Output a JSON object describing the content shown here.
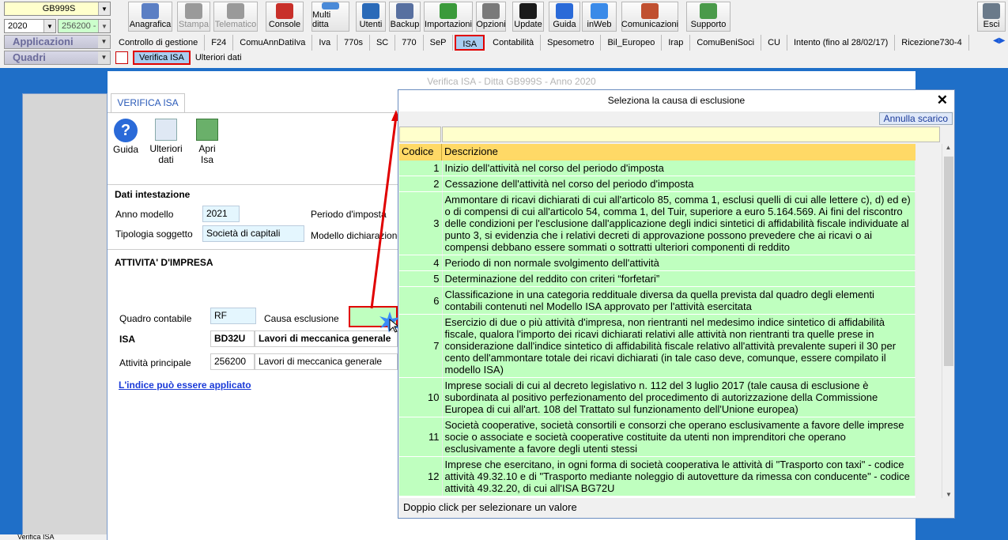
{
  "toolbar": {
    "company": "GB999S",
    "year": "2020",
    "code": "256200 -",
    "buttons": [
      {
        "label": "Anagrafica",
        "icon": "anagrafica-icon",
        "color": "#5b7fc4",
        "enabled": true
      },
      {
        "label": "Stampa",
        "icon": "printer-icon",
        "color": "#9a9a9a",
        "enabled": false
      },
      {
        "label": "Telematico",
        "icon": "telematico-icon",
        "color": "#9a9a9a",
        "enabled": false
      },
      {
        "label": "Console",
        "icon": "console-icon",
        "color": "#c8302a",
        "enabled": true
      },
      {
        "label": "Multi ditta",
        "icon": "multi-ditta-icon",
        "color": "#4a8ad8",
        "enabled": true
      },
      {
        "label": "Utenti",
        "icon": "users-icon",
        "color": "#2a6ab8",
        "enabled": true
      },
      {
        "label": "Backup",
        "icon": "backup-icon",
        "color": "#5870a0",
        "enabled": true
      },
      {
        "label": "Importazioni",
        "icon": "import-icon",
        "color": "#3a9a3a",
        "enabled": true
      },
      {
        "label": "Opzioni",
        "icon": "wrench-icon",
        "color": "#7a7a7a",
        "enabled": true
      },
      {
        "label": "Update",
        "icon": "update-icon",
        "color": "#1a1a1a",
        "enabled": true
      },
      {
        "label": "Guida",
        "icon": "help-icon",
        "color": "#2a6ad8",
        "enabled": true
      },
      {
        "label": "inWeb",
        "icon": "cloud-icon",
        "color": "#3a8ae8",
        "enabled": true
      },
      {
        "label": "Comunicazioni",
        "icon": "comunicazioni-icon",
        "color": "#c05030",
        "enabled": true
      },
      {
        "label": "Supporto",
        "icon": "support-icon",
        "color": "#4a9a4a",
        "enabled": true
      }
    ],
    "exit_label": "Esci"
  },
  "side": {
    "applicazioni": "Applicazioni",
    "quadri": "Quadri"
  },
  "tabs": [
    "Controllo di gestione",
    "F24",
    "ComuAnnDatiIva",
    "Iva",
    "770s",
    "SC",
    "770",
    "SeP",
    "ISA",
    "Contabilità",
    "Spesometro",
    "Bil_Europeo",
    "Irap",
    "ComuBeniSoci",
    "CU",
    "Intento (fino al 28/02/17)",
    "Ricezione730-4"
  ],
  "active_tab": "ISA",
  "subtabs": {
    "verifica": "Verifica ISA",
    "ulteriori": "Ulteriori dati"
  },
  "main": {
    "title": "Verifica ISA - Ditta GB999S - Anno 2020",
    "tab": "VERIFICA ISA",
    "actions": {
      "guida": "Guida",
      "ulteriori": "Ulteriori dati",
      "apri": "Apri Isa"
    },
    "intestazione": "Dati intestazione",
    "anno_label": "Anno modello",
    "anno": "2021",
    "periodo_label": "Periodo d'imposta",
    "tipologia_label": "Tipologia soggetto",
    "tipologia": "Società di capitali",
    "modello_label": "Modello dichiarazione",
    "attivita_title": "ATTIVITA' D'IMPRESA",
    "quadro_label": "Quadro contabile",
    "quadro": "RF",
    "causa_label": "Causa esclusione",
    "isa_label": "ISA",
    "isa_code": "BD32U",
    "isa_desc": "Lavori di meccanica generale",
    "att_label": "Attività principale",
    "att_code": "256200",
    "att_desc": "Lavori di meccanica generale",
    "link": "L'indice può essere applicato",
    "status": "Verifica ISA"
  },
  "dialog": {
    "title": "Seleziona la causa di esclusione",
    "clear": "Annulla scarico",
    "col_code": "Codice",
    "col_desc": "Descrizione",
    "footer": "Doppio click per selezionare un valore",
    "rows": [
      {
        "code": "1",
        "desc": "Inizio dell'attività nel corso del periodo d'imposta"
      },
      {
        "code": "2",
        "desc": "Cessazione dell'attività nel corso del periodo d'imposta"
      },
      {
        "code": "3",
        "desc": "Ammontare di ricavi dichiarati di cui all'articolo 85, comma 1, esclusi quelli di cui alle lettere c), d) ed e) o di compensi di cui all'articolo 54, comma 1, del Tuir, superiore a euro 5.164.569. Ai fini del riscontro delle condizioni per l'esclusione dall'applicazione degli indici sintetici di affidabilità fiscale individuate al punto 3, si evidenzia che i relativi decreti di approvazione possono prevedere che ai ricavi o ai compensi debbano essere sommati o sottratti ulteriori componenti di reddito"
      },
      {
        "code": "4",
        "desc": "Periodo di non normale svolgimento dell'attività"
      },
      {
        "code": "5",
        "desc": "Determinazione del reddito con criteri “forfetari”"
      },
      {
        "code": "6",
        "desc": "Classificazione in una categoria reddituale diversa da quella prevista dal quadro degli elementi contabili contenuti nel Modello ISA approvato per l'attività esercitata"
      },
      {
        "code": "7",
        "desc": "Esercizio di due o più attività d'impresa, non rientranti nel medesimo indice sintetico di affidabilità fiscale, qualora l'importo dei ricavi dichiarati relativi alle attività non rientranti tra quelle prese in considerazione dall'indice sintetico di affidabilità fiscale relativo all'attività prevalente superi il 30 per cento dell'ammontare totale dei ricavi dichiarati (in tale caso deve, comunque, essere compilato il modello ISA)"
      },
      {
        "code": "10",
        "desc": "Imprese sociali di cui al decreto legislativo n. 112 del 3 luglio 2017 (tale causa di esclusione è subordinata al positivo perfezionamento del procedimento di autorizzazione della Commissione Europea di cui all'art. 108 del Trattato sul funzionamento dell'Unione europea)"
      },
      {
        "code": "11",
        "desc": "Società cooperative, società consortili e consorzi che operano esclusivamente a favore delle imprese socie o associate e società cooperative costituite da utenti non imprenditori che operano esclusivamente a favore degli utenti stessi"
      },
      {
        "code": "12",
        "desc": "Imprese che esercitano, in ogni forma di società cooperativa le attività di \"Trasporto con taxi\" - codice attività 49.32.10 e di \"Trasporto mediante noleggio di autovetture da rimessa con conducente\" - codice attività 49.32.20, di cui all'ISA BG72U"
      }
    ]
  }
}
